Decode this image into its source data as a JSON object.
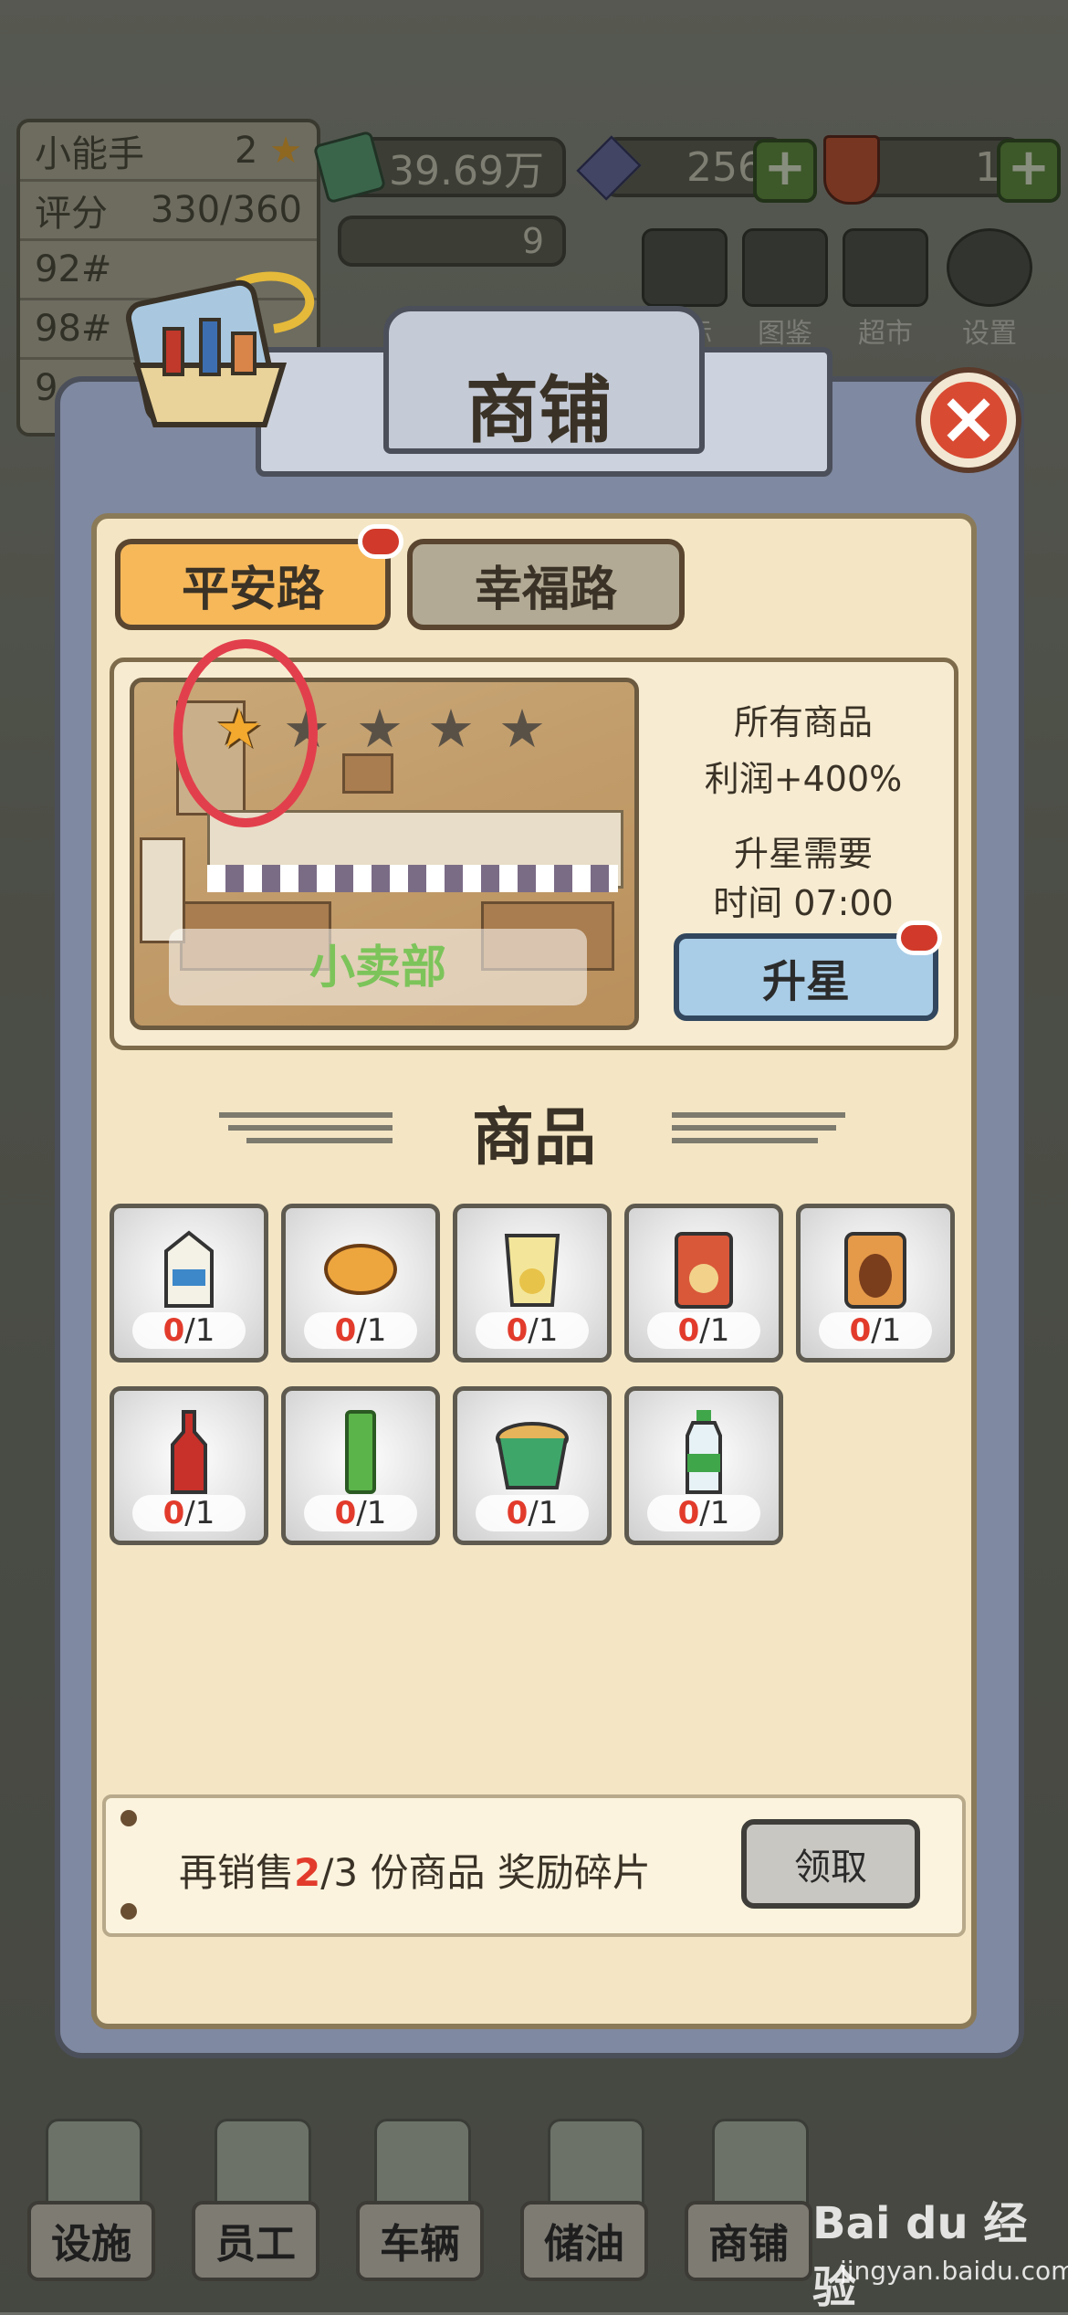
{
  "hud": {
    "player_title": "小能手",
    "player_level": "2",
    "score_label": "评分",
    "score_value": "330/360",
    "station_rows": [
      "92#",
      "98#",
      "9"
    ],
    "money": "39.69万",
    "gems": "256",
    "tickets": "1",
    "sub_counter": "9",
    "top_buttons": [
      "目标",
      "图鉴",
      "超市",
      "设置"
    ]
  },
  "modal": {
    "title": "商铺",
    "tabs": [
      {
        "label": "平安路",
        "active": true
      },
      {
        "label": "幸福路",
        "active": false
      }
    ],
    "shop": {
      "name": "小卖部",
      "stars_total": 5,
      "stars_filled": 1,
      "profit_line1": "所有商品",
      "profit_line2": "利润+400%",
      "upgrade_line1": "升星需要",
      "upgrade_line2": "时间 07:00",
      "upgrade_button": "升星"
    },
    "goods_heading": "商品",
    "items": [
      {
        "name": "milk",
        "have": "0",
        "total": "/1"
      },
      {
        "name": "bread",
        "have": "0",
        "total": "/1"
      },
      {
        "name": "chips",
        "have": "0",
        "total": "/1"
      },
      {
        "name": "noodles-pack",
        "have": "0",
        "total": "/1"
      },
      {
        "name": "egg",
        "have": "0",
        "total": "/1"
      },
      {
        "name": "cola",
        "have": "0",
        "total": "/1"
      },
      {
        "name": "gum",
        "have": "0",
        "total": "/1"
      },
      {
        "name": "cup-noodles",
        "have": "0",
        "total": "/1"
      },
      {
        "name": "water",
        "have": "0",
        "total": "/1"
      }
    ],
    "reward": {
      "prefix": "再销售",
      "progress": "2",
      "rest": "/3 份商品  奖励碎片",
      "claim_button": "领取"
    }
  },
  "bottom_nav": [
    "设施",
    "员工",
    "车辆",
    "储油",
    "商铺"
  ],
  "watermark": {
    "main": "Bai du 经验",
    "sub": "jingyan.baidu.com"
  },
  "colors": {
    "accent_orange": "#f7b85a",
    "upgrade_blue": "#a9cde7",
    "count_red": "#e23b2c",
    "shop_label_green": "#7cc45a",
    "highlight_circle": "#e23f4c"
  }
}
